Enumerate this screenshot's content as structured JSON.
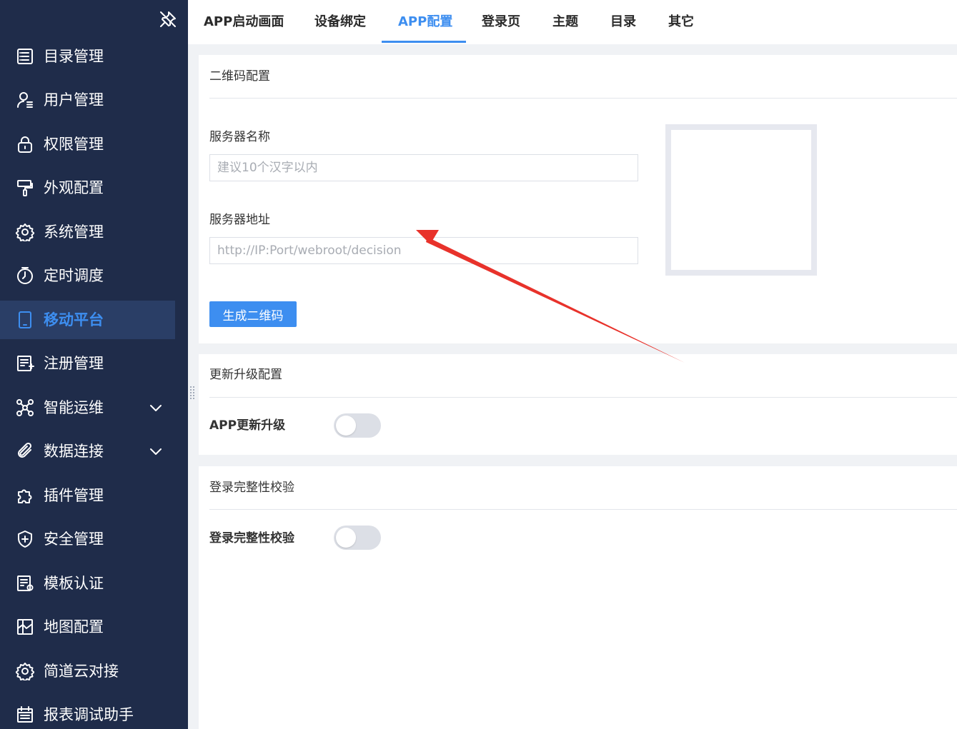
{
  "sidebar": {
    "items": [
      {
        "label": "目录管理",
        "icon": "list-icon"
      },
      {
        "label": "用户管理",
        "icon": "user-icon"
      },
      {
        "label": "权限管理",
        "icon": "lock-icon"
      },
      {
        "label": "外观配置",
        "icon": "paint-roller-icon"
      },
      {
        "label": "系统管理",
        "icon": "gear-icon"
      },
      {
        "label": "定时调度",
        "icon": "timer-icon"
      },
      {
        "label": "移动平台",
        "icon": "tablet-icon",
        "active": true
      },
      {
        "label": "注册管理",
        "icon": "register-icon"
      },
      {
        "label": "智能运维",
        "icon": "network-icon",
        "expandable": true
      },
      {
        "label": "数据连接",
        "icon": "paperclip-icon",
        "expandable": true
      },
      {
        "label": "插件管理",
        "icon": "puzzle-icon"
      },
      {
        "label": "安全管理",
        "icon": "shield-icon"
      },
      {
        "label": "模板认证",
        "icon": "template-cert-icon"
      },
      {
        "label": "地图配置",
        "icon": "map-icon"
      },
      {
        "label": "简道云对接",
        "icon": "gear-icon"
      },
      {
        "label": "报表调试助手",
        "icon": "calendar-icon"
      }
    ]
  },
  "tabs": [
    {
      "label": "APP启动画面"
    },
    {
      "label": "设备绑定"
    },
    {
      "label": "APP配置",
      "active": true
    },
    {
      "label": "登录页"
    },
    {
      "label": "主题"
    },
    {
      "label": "目录"
    },
    {
      "label": "其它"
    }
  ],
  "qr_section": {
    "title": "二维码配置",
    "server_name_label": "服务器名称",
    "server_name_placeholder": "建议10个汉字以内",
    "server_name_value": "",
    "server_addr_label": "服务器地址",
    "server_addr_placeholder": "http://IP:Port/webroot/decision",
    "server_addr_value": "",
    "generate_button": "生成二维码"
  },
  "update_section": {
    "title": "更新升级配置",
    "toggle_label": "APP更新升级",
    "toggle_on": false
  },
  "integrity_section": {
    "title": "登录完整性校验",
    "toggle_label": "登录完整性校验",
    "toggle_on": false
  },
  "colors": {
    "sidebar_bg": "#1f2c4a",
    "accent": "#3d8ef0",
    "annotation_arrow": "#e8322b"
  }
}
